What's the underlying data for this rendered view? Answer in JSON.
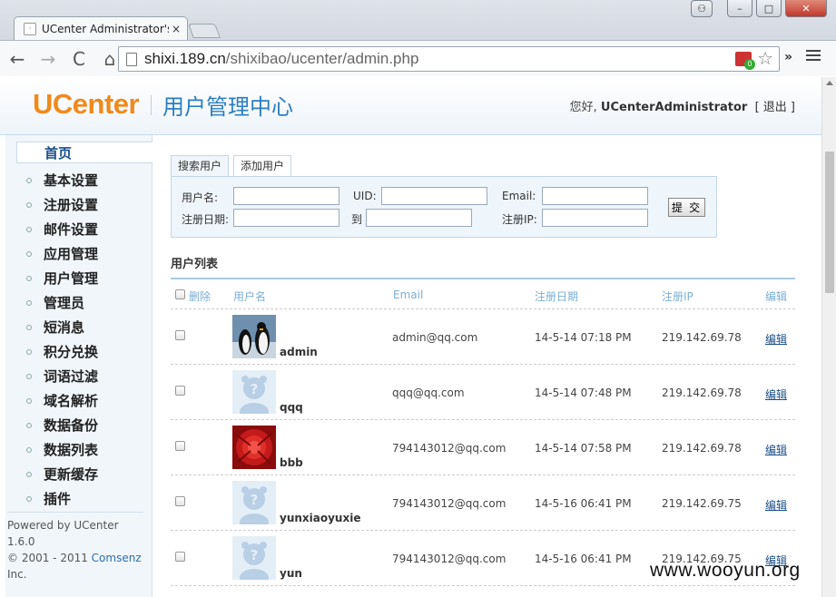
{
  "browser": {
    "tab_title": "UCenter Administrator's",
    "tab_close": "×",
    "url_host": "shixi.189.cn",
    "url_path": "/shixibao/ucenter/admin.php",
    "back_glyph": "←",
    "forward_glyph": "→",
    "reload_glyph": "C",
    "home_glyph": "⌂",
    "ext_badge": "0",
    "more_glyph": "»",
    "star_glyph": "☆",
    "win_min": "–",
    "win_max": "□",
    "win_close": "✕",
    "user_glyph": "⚇"
  },
  "header": {
    "logo": "UCenter",
    "title": "用户管理中心",
    "greeting_prefix": "您好,",
    "username": "UCenterAdministrator",
    "logout_label": "[ 退出 ]"
  },
  "sidebar": {
    "items": [
      {
        "label": "首页",
        "active": true
      },
      {
        "label": "基本设置"
      },
      {
        "label": "注册设置"
      },
      {
        "label": "邮件设置"
      },
      {
        "label": "应用管理"
      },
      {
        "label": "用户管理"
      },
      {
        "label": "管理员"
      },
      {
        "label": "短消息"
      },
      {
        "label": "积分兑换"
      },
      {
        "label": "词语过滤"
      },
      {
        "label": "域名解析"
      },
      {
        "label": "数据备份"
      },
      {
        "label": "数据列表"
      },
      {
        "label": "更新缓存"
      },
      {
        "label": "插件"
      }
    ],
    "powered_line1": "Powered by UCenter 1.6.0",
    "powered_line2_prefix": "© 2001 - 2011 ",
    "powered_link": "Comsenz",
    "powered_line3": "Inc."
  },
  "search": {
    "tab_search": "搜索用户",
    "tab_add": "添加用户",
    "label_username": "用户名:",
    "label_uid": "UID:",
    "label_email": "Email:",
    "label_regdate": "注册日期:",
    "label_to": "到",
    "label_regip": "注册IP:",
    "username_value": "",
    "uid_value": "",
    "email_value": "",
    "regdate_from_value": "",
    "regdate_to_value": "",
    "regip_value": "",
    "submit_label": "提 交"
  },
  "user_list": {
    "title": "用户列表",
    "columns": {
      "delete": "删除",
      "username": "用户名",
      "email": "Email",
      "regdate": "注册日期",
      "regip": "注册IP",
      "edit": "编辑"
    },
    "rows": [
      {
        "username": "admin",
        "email": "admin@qq.com",
        "regdate": "14-5-14 07:18 PM",
        "regip": "219.142.69.78",
        "edit": "编辑",
        "avatar": "penguin-photo"
      },
      {
        "username": "qqq",
        "email": "qqq@qq.com",
        "regdate": "14-5-14 07:48 PM",
        "regip": "219.142.69.78",
        "edit": "编辑",
        "avatar": "default-avatar"
      },
      {
        "username": "bbb",
        "email": "794143012@qq.com",
        "regdate": "14-5-14 07:58 PM",
        "regip": "219.142.69.78",
        "edit": "编辑",
        "avatar": "red-flower-photo"
      },
      {
        "username": "yunxiaoyuxie",
        "email": "794143012@qq.com",
        "regdate": "14-5-16 06:41 PM",
        "regip": "219.142.69.75",
        "edit": "编辑",
        "avatar": "default-avatar"
      },
      {
        "username": "yun",
        "email": "794143012@qq.com",
        "regdate": "14-5-16 06:41 PM",
        "regip": "219.142.69.75",
        "edit": "编辑",
        "avatar": "default-avatar"
      }
    ]
  },
  "watermark": "www.wooyun.org",
  "colors": {
    "logo_orange": "#f08a1c",
    "title_blue": "#2b7fc0",
    "header_text_blue": "#7aaed4",
    "link_blue": "#1a4f8a"
  }
}
